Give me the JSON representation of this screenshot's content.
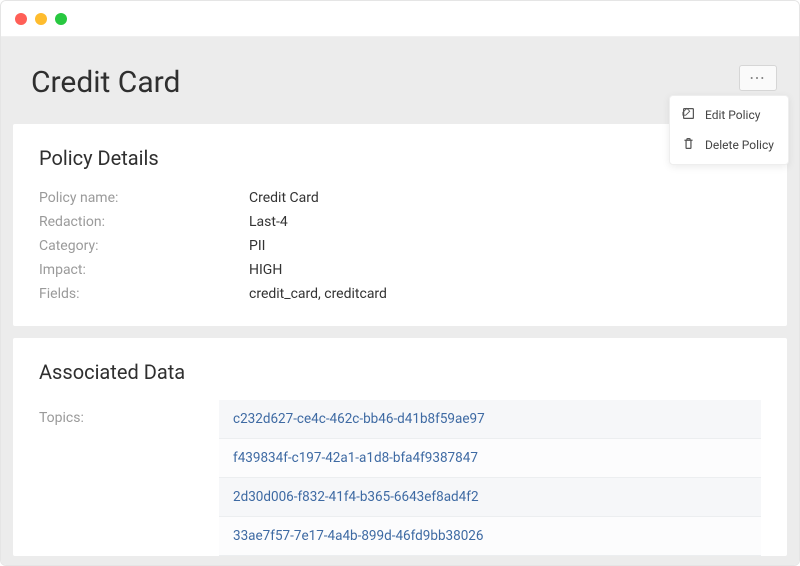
{
  "header": {
    "title": "Credit Card"
  },
  "menu": {
    "more_glyph": "⋯",
    "edit_label": "Edit Policy",
    "delete_label": "Delete Policy"
  },
  "policy_details": {
    "section_title": "Policy Details",
    "rows": [
      {
        "label": "Policy name:",
        "value": "Credit Card"
      },
      {
        "label": "Redaction:",
        "value": "Last-4"
      },
      {
        "label": "Category:",
        "value": "PII"
      },
      {
        "label": "Impact:",
        "value": "HIGH"
      },
      {
        "label": "Fields:",
        "value": "credit_card, creditcard"
      }
    ]
  },
  "associated_data": {
    "section_title": "Associated Data",
    "topics_label": "Topics:",
    "topics": [
      "c232d627-ce4c-462c-bb46-d41b8f59ae97",
      "f439834f-c197-42a1-a1d8-bfa4f9387847",
      "2d30d006-f832-41f4-b365-6643ef8ad4f2",
      "33ae7f57-7e17-4a4b-899d-46fd9bb38026"
    ]
  }
}
